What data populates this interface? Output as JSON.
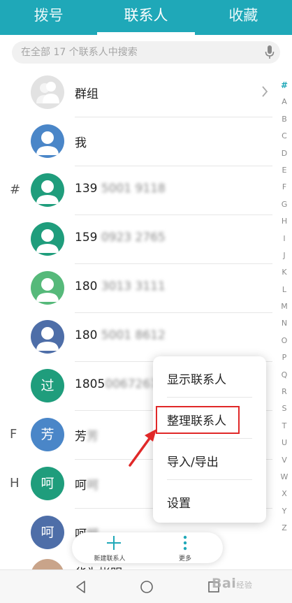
{
  "tabs": [
    {
      "label": "拨号",
      "active": false
    },
    {
      "label": "联系人",
      "active": true
    },
    {
      "label": "收藏",
      "active": false
    }
  ],
  "search": {
    "placeholder": "在全部 17 个联系人中搜索"
  },
  "contacts": [
    {
      "name": "群组",
      "avatar": "group-avatar-icon",
      "color": "#d9d9d9"
    },
    {
      "name": "我",
      "avatar": "person-avatar-icon",
      "color": "#4a86c8"
    },
    {
      "section": "#",
      "name": "139",
      "hidden": "5001 9118",
      "avatar": "person-avatar-icon",
      "color": "#1f9d7c"
    },
    {
      "name": "159",
      "hidden": "0923 2765",
      "avatar": "person-avatar-icon",
      "color": "#1f9d7c"
    },
    {
      "name": "180",
      "hidden": "3013 3111",
      "avatar": "person-avatar-icon",
      "color": "#56b97a"
    },
    {
      "name": "180",
      "hidden": "5001 8612",
      "avatar": "person-avatar-icon",
      "color": "#4e6ea8"
    },
    {
      "name": "1805",
      "hidden": "0067267",
      "avatar_text": "过",
      "color": "#1f9d7c"
    },
    {
      "section": "F",
      "name": "芳",
      "hidden": "芳",
      "avatar_text": "芳",
      "color": "#4a86c8"
    },
    {
      "section": "H",
      "name": "呵",
      "hidden": "呵",
      "avatar_text": "呵",
      "color": "#1f9d7c"
    },
    {
      "name": "呵",
      "hidden": "呵",
      "avatar_text": "呵",
      "color": "#4e6ea8"
    }
  ],
  "partial_contact": {
    "name": "华为帐明"
  },
  "alphabet": [
    "#",
    "A",
    "B",
    "C",
    "D",
    "E",
    "F",
    "G",
    "H",
    "I",
    "J",
    "K",
    "L",
    "M",
    "N",
    "O",
    "P",
    "Q",
    "R",
    "S",
    "T",
    "U",
    "V",
    "W",
    "X",
    "Y",
    "Z"
  ],
  "menu": {
    "items": [
      "显示联系人",
      "整理联系人",
      "导入/导出",
      "设置"
    ],
    "highlighted_index": 1,
    "highlight_color": "#e02828"
  },
  "actionbar": {
    "new_contact_label": "新建联系人",
    "more_label": "更多"
  },
  "watermark": {
    "text": "Bai",
    "text2": "经验"
  },
  "colors": {
    "accent": "#1fa8b8"
  }
}
